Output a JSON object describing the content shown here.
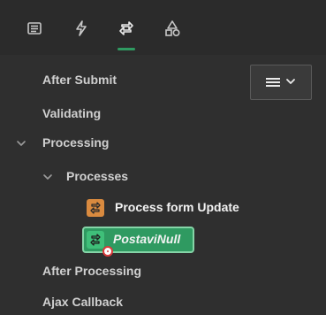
{
  "tabs": [
    {
      "id": "rendering",
      "icon": "list-icon",
      "selected": false
    },
    {
      "id": "dynamic_actions",
      "icon": "lightning-icon",
      "selected": false
    },
    {
      "id": "processing",
      "icon": "refresh-icon",
      "selected": true
    },
    {
      "id": "shared_components",
      "icon": "shapes-icon",
      "selected": false
    }
  ],
  "menu_button": {
    "icon": "hamburger-icon",
    "chevron_icon": "chevron-down-icon"
  },
  "tree": {
    "after_submit": "After Submit",
    "validating": "Validating",
    "processing": "Processing",
    "processes": "Processes",
    "process_form_update": "Process form Update",
    "postavinull": "PostaviNull",
    "after_processing": "After Processing",
    "ajax_callback": "Ajax Callback"
  },
  "colors": {
    "accent_green": "#2f9a61",
    "process_orange": "#d98a3f",
    "background": "#2f2f2f"
  }
}
